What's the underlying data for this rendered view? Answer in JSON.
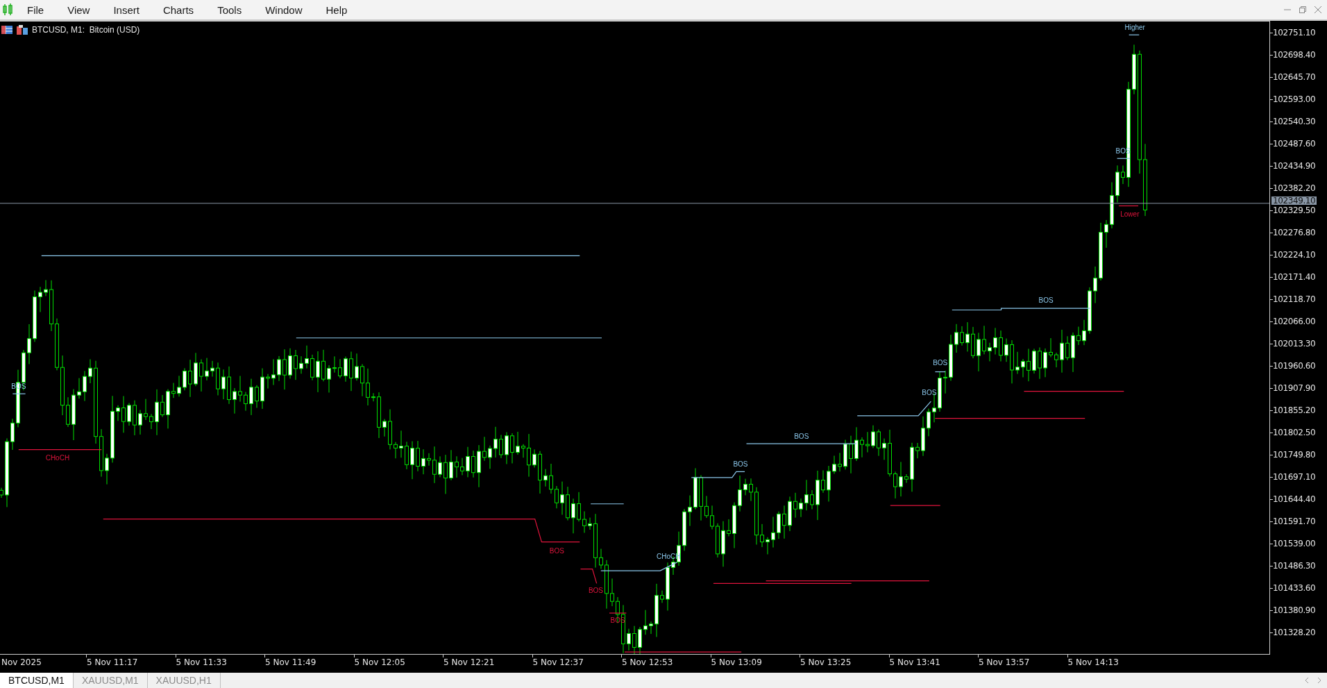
{
  "menu": [
    "File",
    "View",
    "Insert",
    "Charts",
    "Tools",
    "Window",
    "Help"
  ],
  "chart": {
    "title": "BTCUSD, M1:  Bitcoin (USD)",
    "annotations": [
      {
        "text": "Higher",
        "kind": "bullish"
      },
      {
        "text": "BOS",
        "kind": "bullish"
      },
      {
        "text": "Lower",
        "kind": "bearish"
      },
      {
        "text": "BOS",
        "kind": "bullish"
      },
      {
        "text": "BOS",
        "kind": "bullish"
      },
      {
        "text": "BOS",
        "kind": "bullish"
      },
      {
        "text": "BOS",
        "kind": "bullish"
      },
      {
        "text": "BOS",
        "kind": "bullish"
      },
      {
        "text": "CHoCH",
        "kind": "bearish"
      },
      {
        "text": "BOS",
        "kind": "bullish"
      },
      {
        "text": "BOS",
        "kind": "bearish"
      },
      {
        "text": "CHoCH",
        "kind": "bullish"
      },
      {
        "text": "BOS",
        "kind": "bearish"
      },
      {
        "text": "BOS",
        "kind": "bearish"
      }
    ],
    "price_axis": [
      "102751.10",
      "102698.40",
      "102645.70",
      "102593.00",
      "102540.30",
      "102487.60",
      "102434.90",
      "102382.20",
      "102329.50",
      "102276.80",
      "102224.10",
      "102171.40",
      "102118.70",
      "102066.00",
      "102013.30",
      "101960.60",
      "101907.90",
      "101855.20",
      "101802.50",
      "101749.80",
      "101697.10",
      "101644.40",
      "101591.70",
      "101539.00",
      "101486.30",
      "101433.60",
      "101380.90",
      "101328.20"
    ],
    "current_price": "102349.10",
    "time_axis": [
      "Nov 2025",
      "5 Nov 11:17",
      "5 Nov 11:33",
      "5 Nov 11:49",
      "5 Nov 12:05",
      "5 Nov 12:21",
      "5 Nov 12:37",
      "5 Nov 12:53",
      "5 Nov 13:09",
      "5 Nov 13:25",
      "5 Nov 13:41",
      "5 Nov 13:57",
      "5 Nov 14:13"
    ]
  },
  "tabs": [
    {
      "label": "BTCUSD,M1",
      "selected": true
    },
    {
      "label": "XAUUSD,M1",
      "selected": false
    },
    {
      "label": "XAUUSD,H1",
      "selected": false
    }
  ]
}
